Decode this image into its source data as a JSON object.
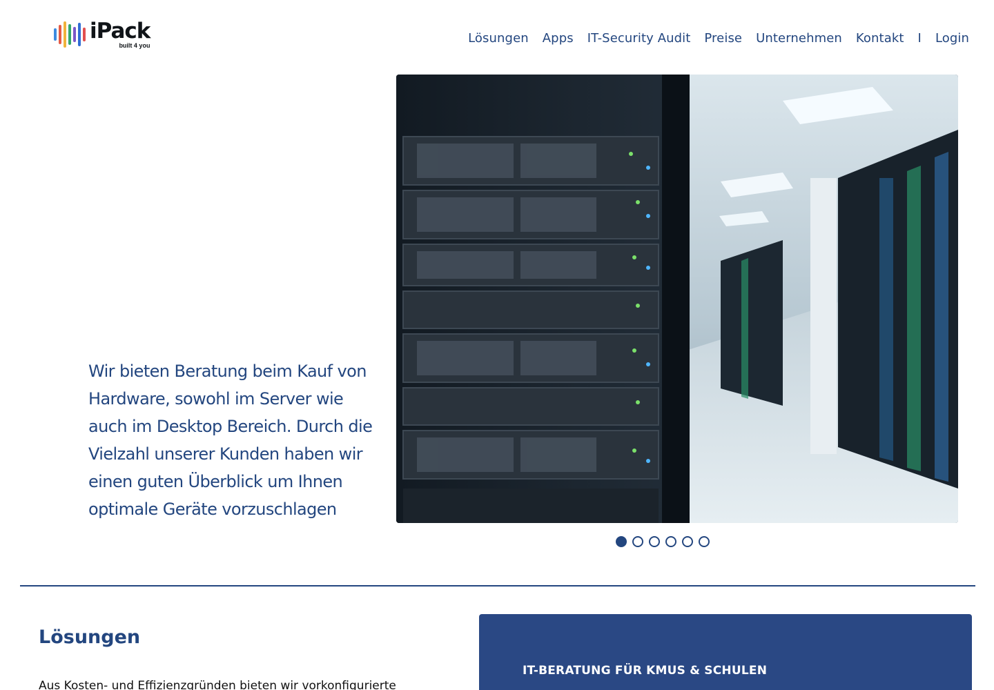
{
  "brand": {
    "name": "iPack",
    "tagline": "built 4 you",
    "logo_bar_colors": [
      "#3d8be0",
      "#e35b46",
      "#f0b33b",
      "#33a86b",
      "#7a57c8",
      "#2f6dd5",
      "#e24f4f"
    ]
  },
  "nav": {
    "items": [
      {
        "label": "Lösungen"
      },
      {
        "label": "Apps"
      },
      {
        "label": "IT-Security Audit"
      },
      {
        "label": "Preise"
      },
      {
        "label": "Unternehmen"
      },
      {
        "label": "Kontakt"
      },
      {
        "label": "I"
      },
      {
        "label": "Login"
      }
    ]
  },
  "hero": {
    "text": "Wir bieten Beratung beim Kauf von Hardware, sowohl im Server wie auch im Desktop Bereich. Durch die Vielzahl unserer Kunden haben wir einen guten Überblick um Ihnen optimale Geräte vorzuschlagen",
    "slides_total": 6,
    "active_slide": 1,
    "image_description_icon": "server-rack-photo"
  },
  "solutions": {
    "title": "Lösungen",
    "text": "Aus Kosten- und Effizienzgründen bieten wir vorkonfigurierte"
  },
  "card": {
    "title": "IT-BERATUNG FÜR KMUS & SCHULEN"
  },
  "colors": {
    "primary": "#23467f",
    "card_bg": "#2a4884",
    "text_dark": "#111111"
  }
}
